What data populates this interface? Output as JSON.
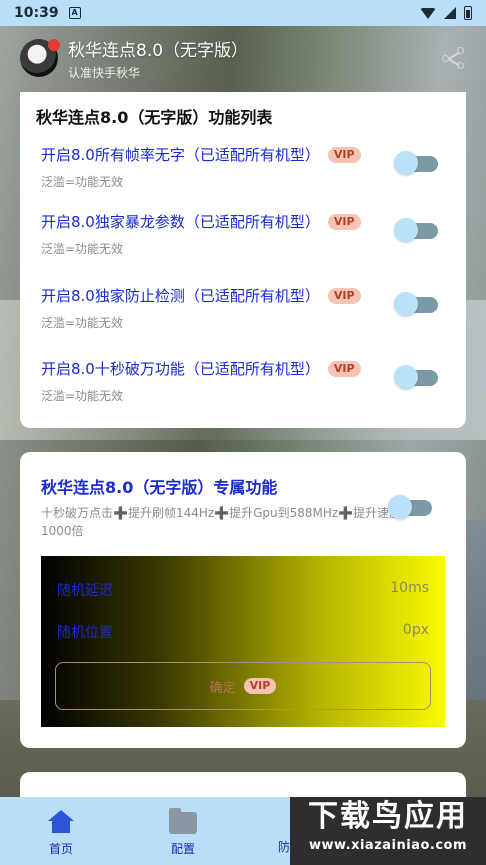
{
  "status_bar": {
    "time": "10:39",
    "notif_badge": "A"
  },
  "header": {
    "title": "秋华连点8.0（无字版）",
    "subtitle": "认准快手秋华"
  },
  "card1": {
    "title": "秋华连点8.0（无字版）功能列表",
    "items": [
      {
        "label": "开启8.0所有帧率无字（已适配所有机型）",
        "sub": "泛滥=功能无效",
        "vip": "VIP",
        "enabled": false
      },
      {
        "label": "开启8.0独家暴龙参数（已适配所有机型）",
        "sub": "泛滥=功能无效",
        "vip": "VIP",
        "enabled": false
      },
      {
        "label": "开启8.0独家防止检测（已适配所有机型）",
        "sub": "泛滥=功能无效",
        "vip": "VIP",
        "enabled": false
      },
      {
        "label": "开启8.0十秒破万功能（已适配所有机型）",
        "sub": "泛滥=功能无效",
        "vip": "VIP",
        "enabled": false
      }
    ]
  },
  "card2": {
    "title": "秋华连点8.0（无字版）专属功能",
    "desc": "十秒破万点击➕提升刷帧144Hz➕提升Gpu到588MHz➕提升速度1000倍",
    "enabled": false,
    "rows": [
      {
        "key": "随机延迟",
        "value": "10ms"
      },
      {
        "key": "随机位置",
        "value": "0px"
      }
    ],
    "button_label": "确定",
    "button_vip": "VIP"
  },
  "bottom_nav": {
    "items": [
      {
        "label": "首页",
        "icon": "home-icon",
        "active": true
      },
      {
        "label": "配置",
        "icon": "folder-icon",
        "active": false
      }
    ],
    "partial_label": "防"
  },
  "watermark": {
    "line1": "下载鸟应用",
    "line2": "www.xiazainiao.com"
  },
  "colors": {
    "accent": "#1a2bd0",
    "nav_bg": "#b9dff8",
    "vip_bg": "#f5c4b5",
    "toggle_knob": "#b9e1f8"
  }
}
